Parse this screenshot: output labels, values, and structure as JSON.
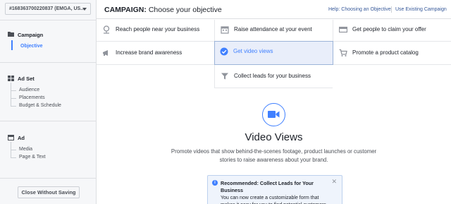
{
  "account": {
    "label": "#168363700220837 (EMGA, US..."
  },
  "sidebar": {
    "campaign": {
      "title": "Campaign",
      "items": [
        "Objective"
      ]
    },
    "adset": {
      "title": "Ad Set",
      "items": [
        "Audience",
        "Placements",
        "Budget & Schedule"
      ]
    },
    "ad": {
      "title": "Ad",
      "items": [
        "Media",
        "Page & Text"
      ]
    },
    "close_label": "Close Without Saving"
  },
  "header": {
    "title_prefix": "CAMPAIGN:",
    "title_rest": "Choose your objective",
    "help_link": "Help: Choosing an Objective",
    "existing_link": "Use Existing Campaign"
  },
  "objectives": [
    {
      "label": "Reach people near your business",
      "icon": "location-pin-icon"
    },
    {
      "label": "Raise attendance at your event",
      "icon": "calendar-icon"
    },
    {
      "label": "Get people to claim your offer",
      "icon": "offer-tag-icon"
    },
    {
      "label": "Increase brand awareness",
      "icon": "megaphone-icon"
    },
    {
      "label": "Get video views",
      "icon": "check-circle-icon",
      "selected": true
    },
    {
      "label": "Promote a product catalog",
      "icon": "shopping-cart-icon"
    },
    {
      "label": "Collect leads for your business",
      "icon": "funnel-icon"
    }
  ],
  "main": {
    "icon": "video-camera-icon",
    "title": "Video Views",
    "description": "Promote videos that show behind-the-scenes footage, product launches or customer stories to raise awareness about your brand."
  },
  "recommendation": {
    "title": "Recommended: Collect Leads for Your Business",
    "body": "You can now create a customizable form that makes it easy for you to find potential customers."
  },
  "colors": {
    "accent": "#4080ff",
    "selected_bg": "#e9eefa",
    "link": "#365899"
  }
}
